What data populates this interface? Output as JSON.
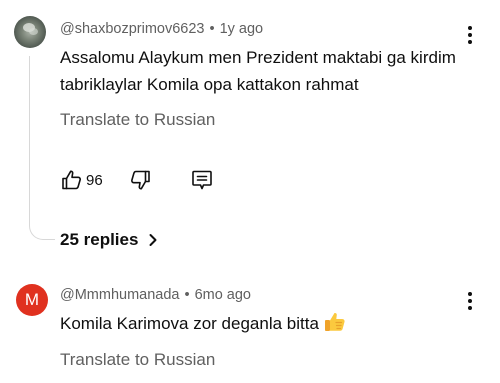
{
  "comments": [
    {
      "author": "@shaxbozprimov6623",
      "separator": "•",
      "time": "1y ago",
      "text": "Assalomu Alaykum men Prezident maktabi ga kirdim tabriklaylar Komila opa kattakon rahmat",
      "translate_label": "Translate to Russian",
      "like_count": "96",
      "replies_label": "25 replies",
      "avatar_icon": "photo-avatar"
    },
    {
      "author": "@Mmmhumanada",
      "separator": "•",
      "time": "6mo ago",
      "text": "Komila Karimova zor deganla bitta",
      "emoji_icon": "thumbs-up-emoji",
      "translate_label": "Translate to Russian",
      "avatar_letter": "M",
      "avatar_color": "#e0311f"
    }
  ],
  "colors": {
    "text_primary": "#0f0f0f",
    "text_secondary": "#606060",
    "thread_line": "#d8d8d8"
  }
}
